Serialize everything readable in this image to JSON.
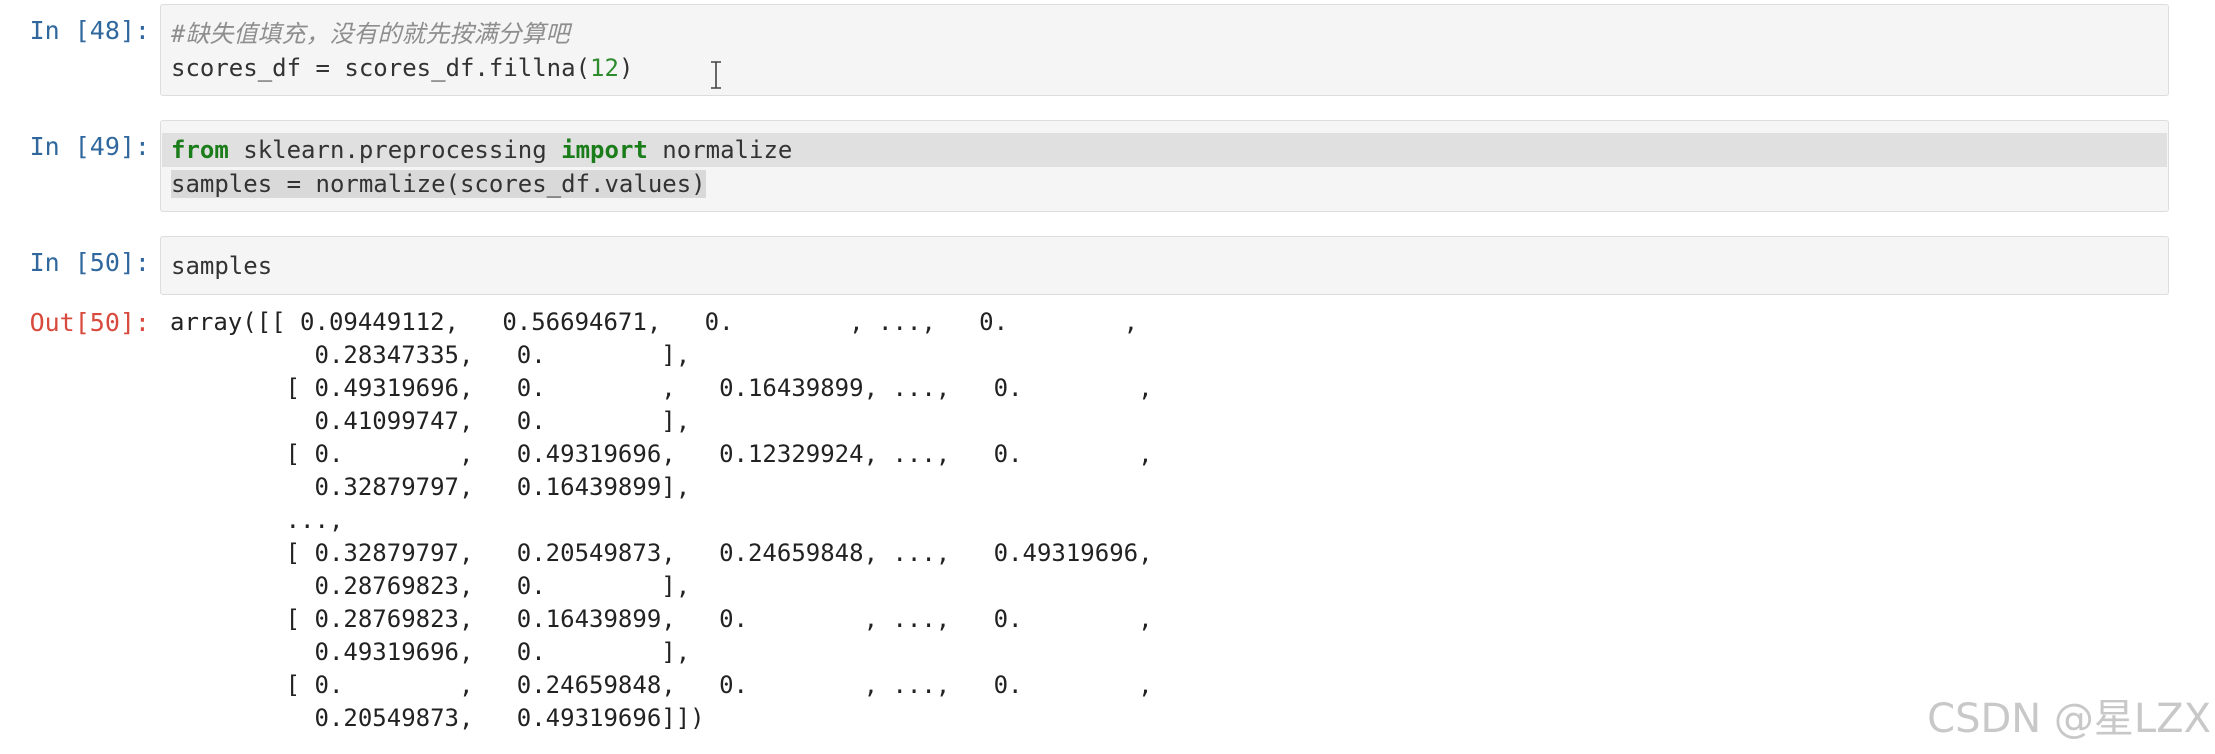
{
  "cells": [
    {
      "prompt": "In [48]:",
      "comment": "#缺失值填充，没有的就先按满分算吧",
      "code_var": "scores_df = scores_df.fillna(",
      "code_num": "12",
      "code_close": ")"
    },
    {
      "prompt": "In [49]:",
      "kw_from": "from",
      "module": " sklearn.preprocessing ",
      "kw_import": "import",
      "import_name": " normalize",
      "line2": "samples = normalize(scores_df.values)"
    },
    {
      "prompt": "In [50]:",
      "code": "samples"
    }
  ],
  "output": {
    "prompt": "Out[50]:",
    "lines": [
      "array([[ 0.09449112,   0.56694671,   0.        , ...,   0.        ,",
      "          0.28347335,   0.        ],",
      "        [ 0.49319696,   0.        ,   0.16439899, ...,   0.        ,",
      "          0.41099747,   0.        ],",
      "        [ 0.        ,   0.49319696,   0.12329924, ...,   0.        ,",
      "          0.32879797,   0.16439899],",
      "        ...,",
      "        [ 0.32879797,   0.20549873,   0.24659848, ...,   0.49319696,",
      "          0.28769823,   0.        ],",
      "        [ 0.28769823,   0.16439899,   0.        , ...,   0.        ,",
      "          0.49319696,   0.        ],",
      "        [ 0.        ,   0.24659848,   0.        , ...,   0.        ,",
      "          0.20549873,   0.49319696]])"
    ]
  },
  "watermark": "CSDN @星LZX",
  "colors": {
    "prompt_in": "#30689e",
    "prompt_out": "#d84a3d",
    "keyword": "#1a7d1a",
    "number": "#2e8b2e",
    "comment": "#8e8e8e",
    "cell_bg": "#f5f5f5"
  }
}
